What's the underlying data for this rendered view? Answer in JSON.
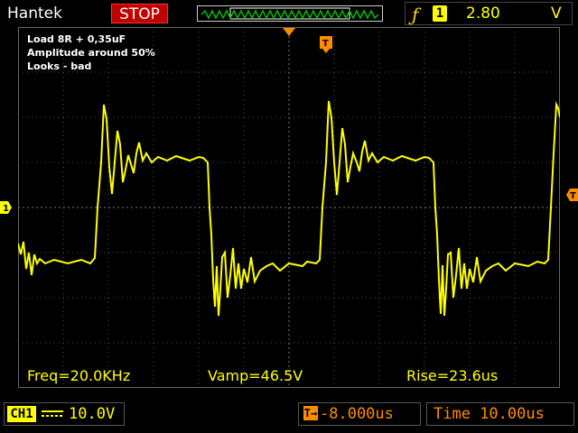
{
  "header": {
    "brand": "Hantek",
    "run_state": "STOP",
    "trigger": {
      "edge_icon": "rising-edge-icon",
      "source": "1",
      "level": "2.80",
      "unit": "V"
    }
  },
  "annotations": [
    "Load 8R + 0,35uF",
    "Amplitude around 50%",
    "Looks - bad"
  ],
  "markers": {
    "channel": "1",
    "trigger": "T"
  },
  "measurements": {
    "freq": "Freq=20.0KHz",
    "vamp": "Vamp=46.5V",
    "rise": "Rise=23.6us"
  },
  "footer": {
    "channel_label": "CH1",
    "coupling": "DC",
    "volts_div": "10.0V",
    "trigger_position": "-8.000us",
    "time_div": "Time 10.00us"
  },
  "colors": {
    "trace": "#ffff00",
    "accent": "#ff8c00",
    "stop": "#c00000",
    "grid": "#555555"
  }
}
